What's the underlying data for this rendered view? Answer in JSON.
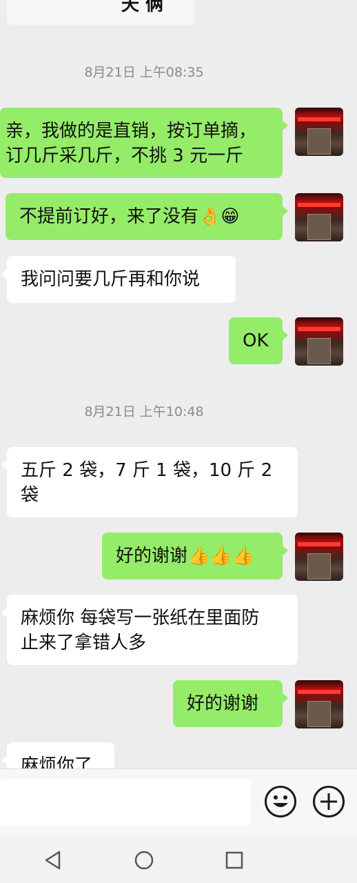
{
  "header": {
    "title": "夭 俩"
  },
  "messages": [
    {
      "type": "time",
      "text": "8月21日 上午08:35"
    },
    {
      "type": "msg",
      "side": "me",
      "lines": "亲，我做的是直销，按订单摘，\n订几斤采几斤，不挑 3 元一斤"
    },
    {
      "type": "msg",
      "side": "me",
      "lines": "不提前订好，来了没有👌😁"
    },
    {
      "type": "msg",
      "side": "other",
      "lines": "我问问要几斤再和你说"
    },
    {
      "type": "msg",
      "side": "me",
      "lines": "OK"
    },
    {
      "type": "time",
      "text": "8月21日 上午10:48"
    },
    {
      "type": "msg",
      "side": "other",
      "lines": "五斤 2 袋，7 斤 1 袋，10 斤 2\n袋"
    },
    {
      "type": "msg",
      "side": "me",
      "lines": "好的谢谢👍👍👍"
    },
    {
      "type": "msg",
      "side": "other",
      "lines": "麻烦你 每袋写一张纸在里面防\n止来了拿错人多"
    },
    {
      "type": "msg",
      "side": "me",
      "lines": "好的谢谢"
    },
    {
      "type": "msg",
      "side": "other",
      "lines": "麻烦你了"
    }
  ],
  "icons": {
    "emoji": "emoji-icon",
    "add": "plus-icon",
    "back": "back-triangle-icon",
    "home": "home-circle-icon",
    "recents": "recents-square-icon"
  },
  "colors": {
    "my_bubble": "#95ec69",
    "other_bubble": "#ffffff",
    "background": "#ededed"
  }
}
